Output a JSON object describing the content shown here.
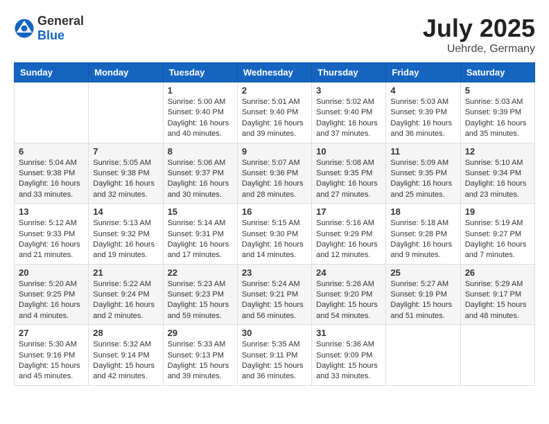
{
  "header": {
    "logo_general": "General",
    "logo_blue": "Blue",
    "month_title": "July 2025",
    "location": "Uehrde, Germany"
  },
  "weekdays": [
    "Sunday",
    "Monday",
    "Tuesday",
    "Wednesday",
    "Thursday",
    "Friday",
    "Saturday"
  ],
  "weeks": [
    [
      {
        "day": "",
        "data": ""
      },
      {
        "day": "",
        "data": ""
      },
      {
        "day": "1",
        "data": "Sunrise: 5:00 AM\nSunset: 9:40 PM\nDaylight: 16 hours and 40 minutes."
      },
      {
        "day": "2",
        "data": "Sunrise: 5:01 AM\nSunset: 9:40 PM\nDaylight: 16 hours and 39 minutes."
      },
      {
        "day": "3",
        "data": "Sunrise: 5:02 AM\nSunset: 9:40 PM\nDaylight: 16 hours and 37 minutes."
      },
      {
        "day": "4",
        "data": "Sunrise: 5:03 AM\nSunset: 9:39 PM\nDaylight: 16 hours and 36 minutes."
      },
      {
        "day": "5",
        "data": "Sunrise: 5:03 AM\nSunset: 9:39 PM\nDaylight: 16 hours and 35 minutes."
      }
    ],
    [
      {
        "day": "6",
        "data": "Sunrise: 5:04 AM\nSunset: 9:38 PM\nDaylight: 16 hours and 33 minutes."
      },
      {
        "day": "7",
        "data": "Sunrise: 5:05 AM\nSunset: 9:38 PM\nDaylight: 16 hours and 32 minutes."
      },
      {
        "day": "8",
        "data": "Sunrise: 5:06 AM\nSunset: 9:37 PM\nDaylight: 16 hours and 30 minutes."
      },
      {
        "day": "9",
        "data": "Sunrise: 5:07 AM\nSunset: 9:36 PM\nDaylight: 16 hours and 28 minutes."
      },
      {
        "day": "10",
        "data": "Sunrise: 5:08 AM\nSunset: 9:35 PM\nDaylight: 16 hours and 27 minutes."
      },
      {
        "day": "11",
        "data": "Sunrise: 5:09 AM\nSunset: 9:35 PM\nDaylight: 16 hours and 25 minutes."
      },
      {
        "day": "12",
        "data": "Sunrise: 5:10 AM\nSunset: 9:34 PM\nDaylight: 16 hours and 23 minutes."
      }
    ],
    [
      {
        "day": "13",
        "data": "Sunrise: 5:12 AM\nSunset: 9:33 PM\nDaylight: 16 hours and 21 minutes."
      },
      {
        "day": "14",
        "data": "Sunrise: 5:13 AM\nSunset: 9:32 PM\nDaylight: 16 hours and 19 minutes."
      },
      {
        "day": "15",
        "data": "Sunrise: 5:14 AM\nSunset: 9:31 PM\nDaylight: 16 hours and 17 minutes."
      },
      {
        "day": "16",
        "data": "Sunrise: 5:15 AM\nSunset: 9:30 PM\nDaylight: 16 hours and 14 minutes."
      },
      {
        "day": "17",
        "data": "Sunrise: 5:16 AM\nSunset: 9:29 PM\nDaylight: 16 hours and 12 minutes."
      },
      {
        "day": "18",
        "data": "Sunrise: 5:18 AM\nSunset: 9:28 PM\nDaylight: 16 hours and 9 minutes."
      },
      {
        "day": "19",
        "data": "Sunrise: 5:19 AM\nSunset: 9:27 PM\nDaylight: 16 hours and 7 minutes."
      }
    ],
    [
      {
        "day": "20",
        "data": "Sunrise: 5:20 AM\nSunset: 9:25 PM\nDaylight: 16 hours and 4 minutes."
      },
      {
        "day": "21",
        "data": "Sunrise: 5:22 AM\nSunset: 9:24 PM\nDaylight: 16 hours and 2 minutes."
      },
      {
        "day": "22",
        "data": "Sunrise: 5:23 AM\nSunset: 9:23 PM\nDaylight: 15 hours and 59 minutes."
      },
      {
        "day": "23",
        "data": "Sunrise: 5:24 AM\nSunset: 9:21 PM\nDaylight: 15 hours and 56 minutes."
      },
      {
        "day": "24",
        "data": "Sunrise: 5:26 AM\nSunset: 9:20 PM\nDaylight: 15 hours and 54 minutes."
      },
      {
        "day": "25",
        "data": "Sunrise: 5:27 AM\nSunset: 9:19 PM\nDaylight: 15 hours and 51 minutes."
      },
      {
        "day": "26",
        "data": "Sunrise: 5:29 AM\nSunset: 9:17 PM\nDaylight: 15 hours and 48 minutes."
      }
    ],
    [
      {
        "day": "27",
        "data": "Sunrise: 5:30 AM\nSunset: 9:16 PM\nDaylight: 15 hours and 45 minutes."
      },
      {
        "day": "28",
        "data": "Sunrise: 5:32 AM\nSunset: 9:14 PM\nDaylight: 15 hours and 42 minutes."
      },
      {
        "day": "29",
        "data": "Sunrise: 5:33 AM\nSunset: 9:13 PM\nDaylight: 15 hours and 39 minutes."
      },
      {
        "day": "30",
        "data": "Sunrise: 5:35 AM\nSunset: 9:11 PM\nDaylight: 15 hours and 36 minutes."
      },
      {
        "day": "31",
        "data": "Sunrise: 5:36 AM\nSunset: 9:09 PM\nDaylight: 15 hours and 33 minutes."
      },
      {
        "day": "",
        "data": ""
      },
      {
        "day": "",
        "data": ""
      }
    ]
  ]
}
